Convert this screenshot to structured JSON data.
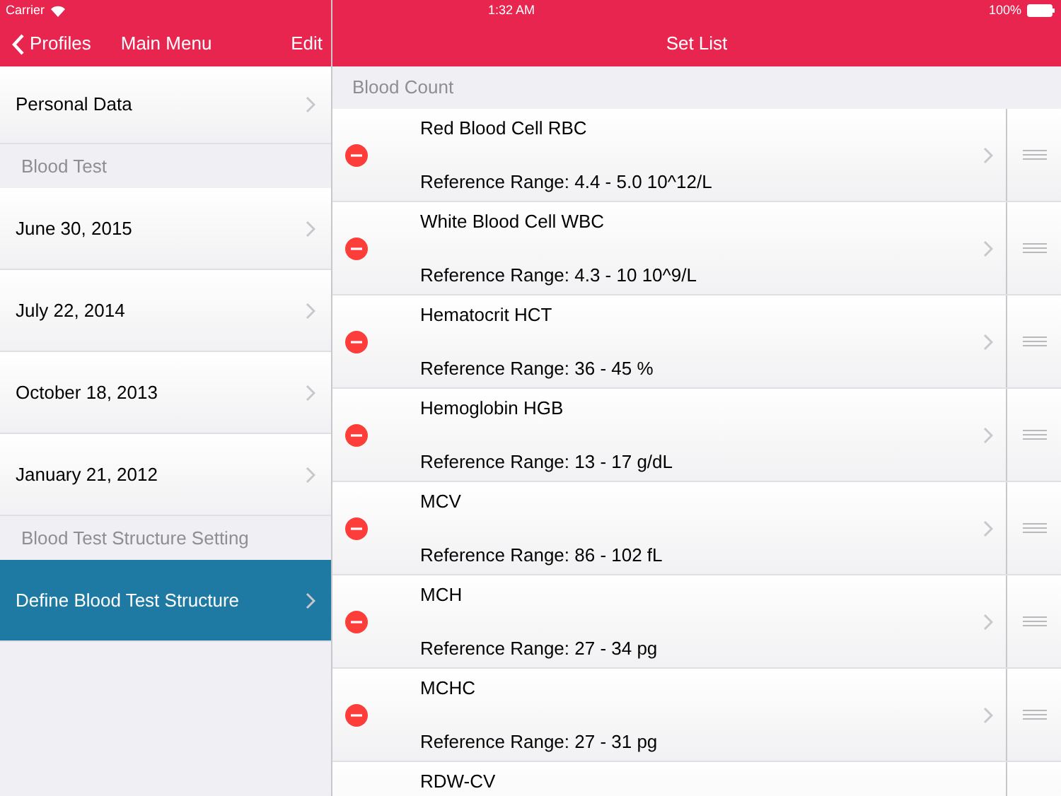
{
  "status_bar": {
    "carrier": "Carrier",
    "time": "1:32 AM",
    "battery": "100%"
  },
  "left_nav": {
    "back": "Profiles",
    "title": "Main Menu",
    "action": "Edit"
  },
  "left_list": [
    {
      "kind": "row",
      "label": "Personal Data",
      "selected": false
    },
    {
      "kind": "header",
      "label": "Blood Test"
    },
    {
      "kind": "row",
      "label": "June 30, 2015",
      "selected": false
    },
    {
      "kind": "row",
      "label": "July 22, 2014",
      "selected": false
    },
    {
      "kind": "row",
      "label": "October 18, 2013",
      "selected": false
    },
    {
      "kind": "row",
      "label": "January 21, 2012",
      "selected": false
    },
    {
      "kind": "header",
      "label": "Blood Test Structure Setting"
    },
    {
      "kind": "row",
      "label": "Define Blood Test Structure",
      "selected": true
    }
  ],
  "right_nav": {
    "title": "Set List"
  },
  "section": "Blood Count",
  "tests": [
    {
      "name": "Red Blood Cell RBC",
      "range": "Reference Range: 4.4 - 5.0 10^12/L"
    },
    {
      "name": "White Blood Cell WBC",
      "range": "Reference Range: 4.3 - 10 10^9/L"
    },
    {
      "name": "Hematocrit HCT",
      "range": "Reference Range: 36 - 45 %"
    },
    {
      "name": "Hemoglobin HGB",
      "range": "Reference Range: 13 - 17 g/dL"
    },
    {
      "name": "MCV",
      "range": "Reference Range: 86 - 102 fL"
    },
    {
      "name": "MCH",
      "range": "Reference Range: 27 - 34 pg"
    },
    {
      "name": "MCHC",
      "range": "Reference Range: 27 - 31 pg"
    },
    {
      "name": "RDW-CV"
    }
  ]
}
